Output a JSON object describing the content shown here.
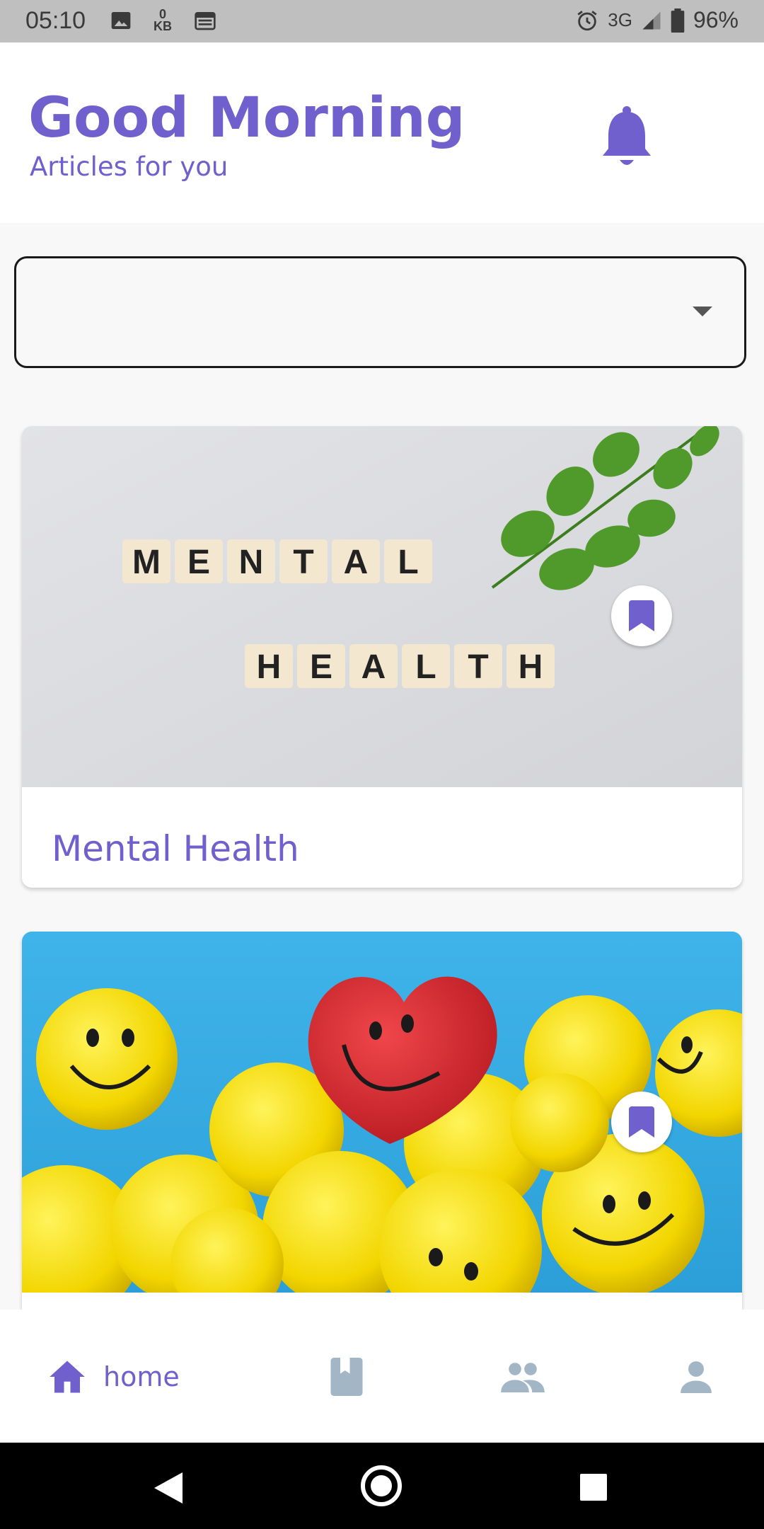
{
  "status_bar": {
    "time": "05:10",
    "data_counter_top": "0",
    "data_counter_bottom": "KB",
    "network": "3G",
    "battery": "96%"
  },
  "header": {
    "greeting": "Good Morning",
    "subtitle": "Articles for you"
  },
  "dropdown": {
    "selected": ""
  },
  "articles": [
    {
      "title": "Mental Health",
      "image_tiles_line1": [
        "M",
        "E",
        "N",
        "T",
        "A",
        "L"
      ],
      "image_tiles_line2": [
        "H",
        "E",
        "A",
        "L",
        "T",
        "H"
      ]
    },
    {
      "title": ""
    }
  ],
  "bottom_nav": {
    "home_label": "home"
  },
  "colors": {
    "accent": "#7060cd",
    "inactive_icon": "#a3b6c6"
  }
}
